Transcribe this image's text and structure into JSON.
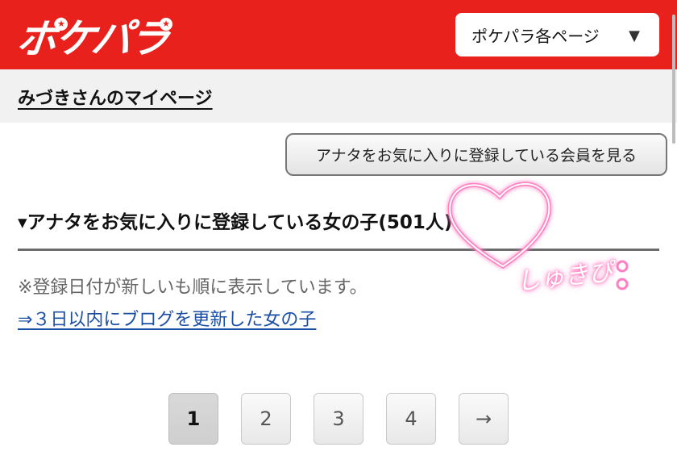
{
  "header": {
    "logo_text": "ポケパラ",
    "page_select_label": "ポケパラ各ページ",
    "page_select_arrow": "▼",
    "brand_color": "#e8211d"
  },
  "subbar": {
    "mypage_label": "みづきさんのマイページ"
  },
  "main": {
    "fav_members_button": "アナタをお気に入りに登録している会員を見る",
    "section_title": "▾アナタをお気に入りに登録している女の子",
    "section_count": "(501人)",
    "note": "※登録日付が新しいも順に表示しています。",
    "blog_link": "⇒３日以内にブログを更新した女の子",
    "link_color": "#1a4fa6"
  },
  "pagination": {
    "pages": [
      "1",
      "2",
      "3",
      "4"
    ],
    "current": "1",
    "next": "→"
  },
  "sticker": {
    "text": "しゅきぴ",
    "glow_color": "#ff6fb8"
  }
}
